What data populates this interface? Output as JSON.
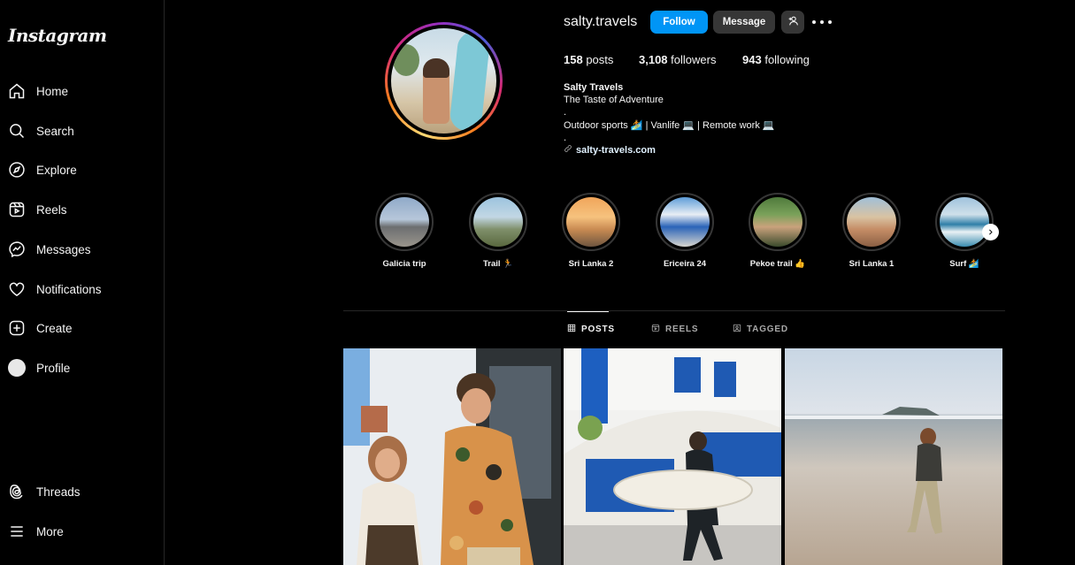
{
  "app": {
    "logo": "Instagram"
  },
  "sidebar": {
    "items": [
      {
        "label": "Home",
        "icon": "home-icon"
      },
      {
        "label": "Search",
        "icon": "search-icon"
      },
      {
        "label": "Explore",
        "icon": "compass-icon"
      },
      {
        "label": "Reels",
        "icon": "reels-icon"
      },
      {
        "label": "Messages",
        "icon": "messenger-icon"
      },
      {
        "label": "Notifications",
        "icon": "heart-icon"
      },
      {
        "label": "Create",
        "icon": "plus-square-icon"
      },
      {
        "label": "Profile",
        "icon": "avatar"
      }
    ],
    "bottom": [
      {
        "label": "Threads",
        "icon": "threads-icon"
      },
      {
        "label": "More",
        "icon": "hamburger-icon"
      }
    ]
  },
  "profile": {
    "username": "salty.travels",
    "follow_label": "Follow",
    "message_label": "Message",
    "stats": {
      "posts_count": "158",
      "posts_label": "posts",
      "followers_count": "3,108",
      "followers_label": "followers",
      "following_count": "943",
      "following_label": "following"
    },
    "bio": {
      "name": "Salty Travels",
      "lines": [
        "The Taste of Adventure",
        ".",
        "Outdoor sports 🏄 | Vanlife 💻 | Remote work 💻",
        "."
      ],
      "link": "salty-travels.com"
    }
  },
  "highlights": [
    {
      "label": "Galicia trip"
    },
    {
      "label": "Trail 🏃"
    },
    {
      "label": "Sri Lanka 2"
    },
    {
      "label": "Ericeira 24"
    },
    {
      "label": "Pekoe trail 👍"
    },
    {
      "label": "Sri Lanka 1"
    },
    {
      "label": "Surf 🏄"
    }
  ],
  "tabs": [
    {
      "label": "POSTS",
      "active": true,
      "icon": "grid-icon"
    },
    {
      "label": "REELS",
      "active": false,
      "icon": "reels-icon"
    },
    {
      "label": "TAGGED",
      "active": false,
      "icon": "tag-icon"
    }
  ],
  "colors": {
    "follow_button": "#0095f6",
    "secondary_button": "#363636",
    "background": "#000000"
  }
}
